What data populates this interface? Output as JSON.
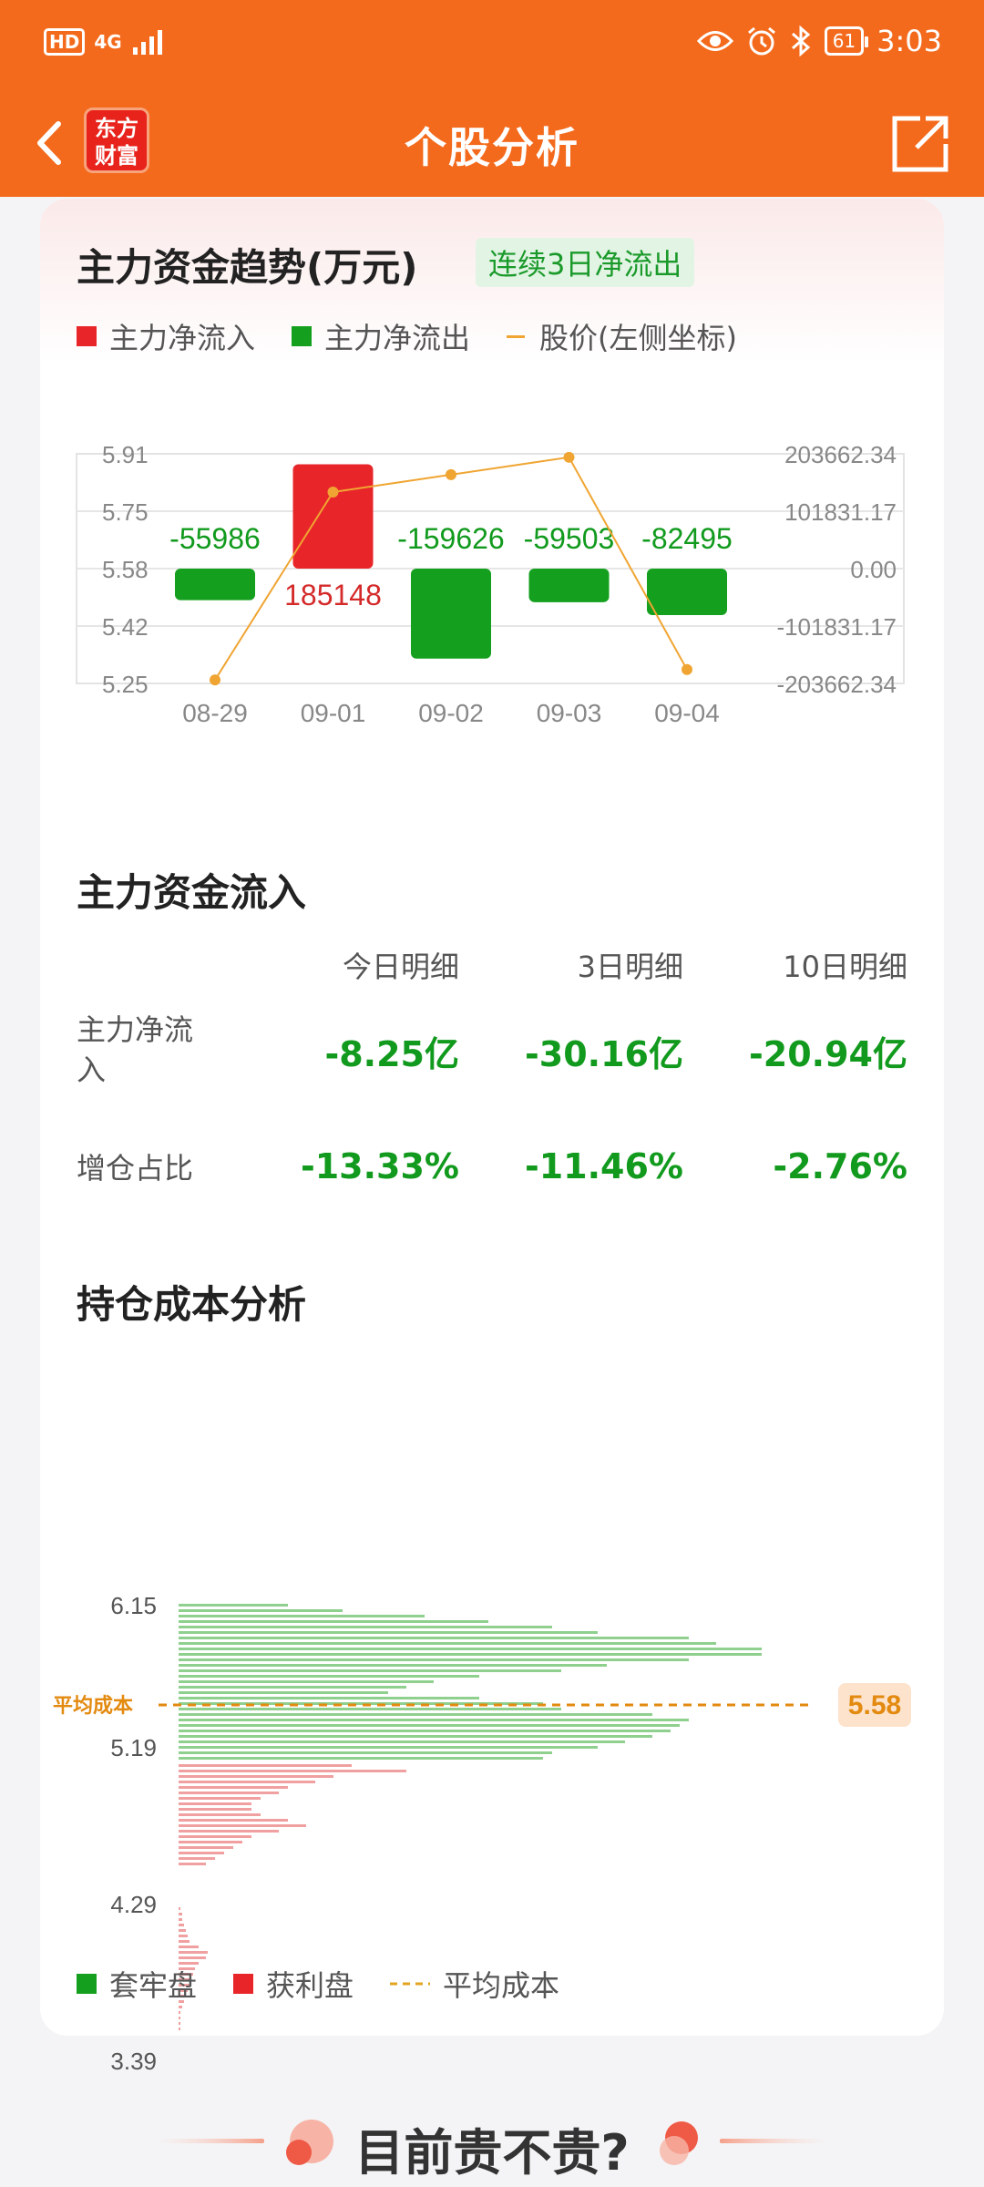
{
  "status_bar": {
    "hd": "HD",
    "signal": "4G",
    "battery": "61",
    "time": "3:03",
    "icons": [
      "eye-icon",
      "alarm-icon",
      "bluetooth-icon"
    ]
  },
  "header": {
    "logo_line1": "东方",
    "logo_line2": "财富",
    "title": "个股分析"
  },
  "trend": {
    "title": "主力资金趋势(万元)",
    "badge": "连续3日净流出",
    "legend": {
      "inflow": "主力净流入",
      "outflow": "主力净流出",
      "price": "股价(左侧坐标)"
    }
  },
  "chart_data": {
    "type": "bar",
    "categories": [
      "08-29",
      "09-01",
      "09-02",
      "09-03",
      "09-04"
    ],
    "series": [
      {
        "name": "主力净流入/净流出",
        "values": [
          -55986,
          185148,
          -159626,
          -59503,
          -82495
        ],
        "labels": [
          "-55986",
          "185148",
          "-159626",
          "-59503",
          "-82495"
        ]
      },
      {
        "name": "股价(左侧坐标)",
        "type": "line",
        "values": [
          5.26,
          5.8,
          5.85,
          5.9,
          5.29
        ]
      }
    ],
    "left_axis": {
      "ticks": [
        "5.91",
        "5.75",
        "5.58",
        "5.42",
        "5.25"
      ],
      "min": 5.25,
      "max": 5.91
    },
    "right_axis": {
      "ticks": [
        "203662.34",
        "101831.17",
        "0.00",
        "-101831.17",
        "-203662.34"
      ],
      "min": -203662.34,
      "max": 203662.34
    },
    "colors": {
      "inflow": "#e8262a",
      "outflow": "#14a01e",
      "price": "#f0a532"
    }
  },
  "fund_flow": {
    "title": "主力资金流入",
    "headers": [
      "今日明细",
      "3日明细",
      "10日明细"
    ],
    "rows": [
      {
        "label": "主力净流入",
        "values": [
          "-8.25亿",
          "-30.16亿",
          "-20.94亿"
        ]
      },
      {
        "label": "增仓占比",
        "values": [
          "-13.33%",
          "-11.46%",
          "-2.76%"
        ]
      }
    ]
  },
  "cost": {
    "title": "持仓成本分析",
    "ticks": [
      "6.15",
      "5.19",
      "4.29",
      "3.39"
    ],
    "avg_label": "平均成本",
    "avg_value": "5.58",
    "legend": {
      "trapped": "套牢盘",
      "profit": "获利盘",
      "avg": "平均成本"
    },
    "colors": {
      "trapped": "#8fd08f",
      "profit": "#f0a0a0",
      "avg": "#e38a10"
    }
  },
  "footer": {
    "text": "目前贵不贵?"
  }
}
